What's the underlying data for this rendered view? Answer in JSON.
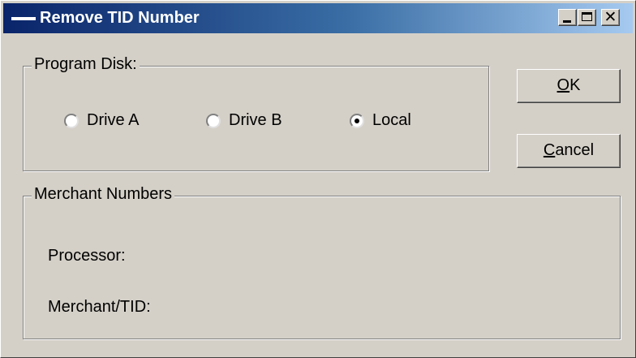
{
  "window": {
    "title": "Remove TID Number",
    "buttons": {
      "minimize_icon": "minimize-icon",
      "maximize_icon": "maximize-icon",
      "close_glyph": "✕"
    }
  },
  "program_disk": {
    "label": "Program Disk:",
    "options": [
      {
        "label": "Drive A",
        "selected": false
      },
      {
        "label": "Drive B",
        "selected": false
      },
      {
        "label": "Local",
        "selected": true
      }
    ]
  },
  "merchant_numbers": {
    "label": "Merchant Numbers",
    "processor_label": "Processor:",
    "merchant_tid_label": "Merchant/TID:"
  },
  "actions": {
    "ok": {
      "mnemonic": "O",
      "rest": "K"
    },
    "cancel": {
      "mnemonic": "C",
      "rest": "ancel"
    }
  }
}
